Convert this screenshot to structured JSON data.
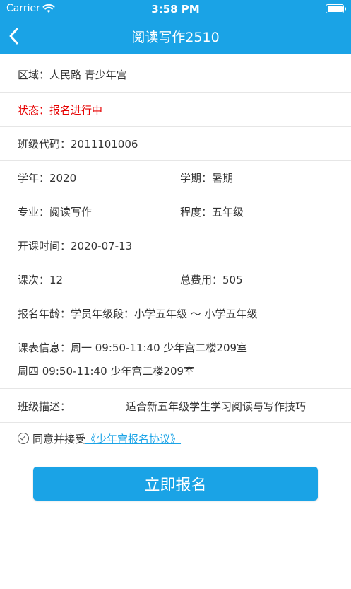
{
  "status_bar": {
    "carrier": "Carrier",
    "time": "3:58 PM"
  },
  "nav": {
    "title": "阅读写作2510",
    "back_icon": "chevron-left-icon"
  },
  "details": {
    "region": "区域：人民路 青少年宫",
    "status": "状态：报名进行中",
    "class_code": "班级代码：2011101006",
    "year": "学年：2020",
    "term": "学期：暑期",
    "major": "专业：阅读写作",
    "level": "程度：五年级",
    "start_time": "开课时间：2020-07-13",
    "sessions": "课次：12",
    "total_fee": "总费用：505",
    "age": "报名年龄：学员年级段：小学五年级 ～ 小学五年级",
    "schedule_line1": "课表信息：周一 09:50-11:40 少年宫二楼209室",
    "schedule_line2": "周四 09:50-11:40 少年宫二楼209室",
    "desc_label": "班级描述：",
    "desc_value": "适合新五年级学生学习阅读与写作技巧"
  },
  "agreement": {
    "text": "同意并接受",
    "link": "《少年宫报名协议》"
  },
  "submit_label": "立即报名",
  "colors": {
    "primary": "#1aa3e6",
    "status_red": "#e60000"
  }
}
